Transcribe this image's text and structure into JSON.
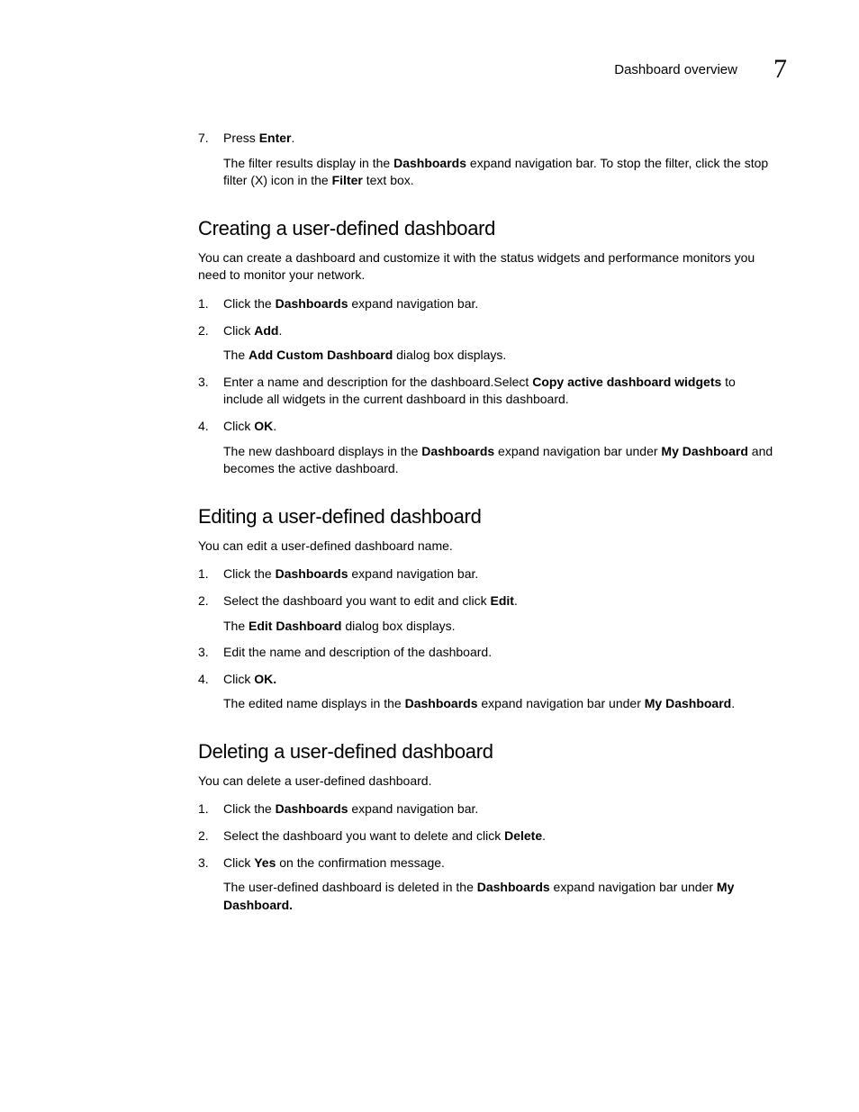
{
  "header": {
    "title": "Dashboard overview",
    "chapter": "7"
  },
  "top": {
    "step7_num": "7",
    "step7": {
      "pre": "Press ",
      "b1": "Enter",
      "post": "."
    },
    "step7_sub": {
      "t1": "The filter results display in the ",
      "b1": "Dashboards",
      "t2": " expand navigation bar. To stop the filter, click the stop filter (X) icon in the ",
      "b2": "Filter",
      "t3": " text box."
    }
  },
  "creating": {
    "heading": "Creating a user-defined dashboard",
    "intro": "You can create a dashboard and customize it with the status widgets and performance monitors you need to monitor your network.",
    "s1": {
      "t1": "Click the ",
      "b1": "Dashboards",
      "t2": " expand navigation bar."
    },
    "s2": {
      "t1": "Click ",
      "b1": "Add",
      "t2": "."
    },
    "s2_sub": {
      "t1": "The ",
      "b1": "Add Custom Dashboard",
      "t2": " dialog box displays."
    },
    "s3": {
      "t1": "Enter a name and description for the dashboard.Select ",
      "b1": "Copy active dashboard widgets",
      "t2": " to include all widgets in the current dashboard in this dashboard."
    },
    "s4": {
      "t1": "Click ",
      "b1": "OK",
      "t2": "."
    },
    "s4_sub": {
      "t1": "The new dashboard displays in the ",
      "b1": "Dashboards",
      "t2": " expand navigation bar under ",
      "b2": "My Dashboard",
      "t3": " and becomes the active dashboard."
    }
  },
  "editing": {
    "heading": "Editing a user-defined dashboard",
    "intro": "You can edit a user-defined dashboard name.",
    "s1": {
      "t1": "Click the ",
      "b1": "Dashboards",
      "t2": " expand navigation bar."
    },
    "s2": {
      "t1": "Select the dashboard you want to edit and click ",
      "b1": "Edit",
      "t2": "."
    },
    "s2_sub": {
      "t1": "The ",
      "b1": "Edit Dashboard",
      "t2": " dialog box displays."
    },
    "s3": {
      "t1": "Edit the name and description of the dashboard."
    },
    "s4": {
      "t1": "Click ",
      "b1": "OK.",
      "t2": ""
    },
    "s4_sub": {
      "t1": "The edited name displays in the ",
      "b1": "Dashboards",
      "t2": " expand navigation bar under ",
      "b2": "My Dashboard",
      "t3": "."
    }
  },
  "deleting": {
    "heading": "Deleting a user-defined dashboard",
    "intro": "You can delete a user-defined dashboard.",
    "s1": {
      "t1": "Click the ",
      "b1": "Dashboards",
      "t2": " expand navigation bar."
    },
    "s2": {
      "t1": "Select the dashboard you want to delete and click ",
      "b1": "Delete",
      "t2": "."
    },
    "s3": {
      "t1": "Click ",
      "b1": "Yes",
      "t2": " on the confirmation message."
    },
    "s3_sub": {
      "t1": "The user-defined dashboard is deleted in the ",
      "b1": "Dashboards",
      "t2": " expand navigation bar under ",
      "b2": "My Dashboard.",
      "t3": ""
    }
  }
}
